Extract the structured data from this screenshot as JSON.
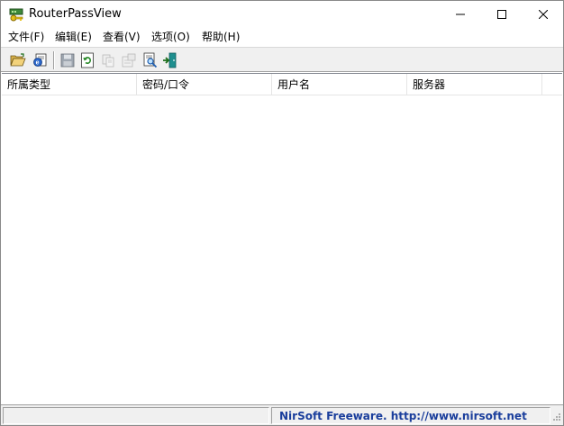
{
  "window": {
    "title": "RouterPassView",
    "icon": "router-key-icon"
  },
  "menu": [
    {
      "label": "文件(F)"
    },
    {
      "label": "编辑(E)"
    },
    {
      "label": "查看(V)"
    },
    {
      "label": "选项(O)"
    },
    {
      "label": "帮助(H)"
    }
  ],
  "toolbar": {
    "buttons": [
      "open-file-icon",
      "open-ie-icon",
      "save-icon",
      "refresh-icon",
      "copy-icon",
      "properties-icon",
      "find-icon",
      "exit-icon"
    ]
  },
  "list": {
    "columns": [
      "所属类型",
      "密码/口令",
      "用户名",
      "服务器"
    ],
    "rows": []
  },
  "status": {
    "left_text": "",
    "link_text": "NirSoft Freeware.  http://www.nirsoft.net",
    "link_color": "#1a3e9c"
  }
}
